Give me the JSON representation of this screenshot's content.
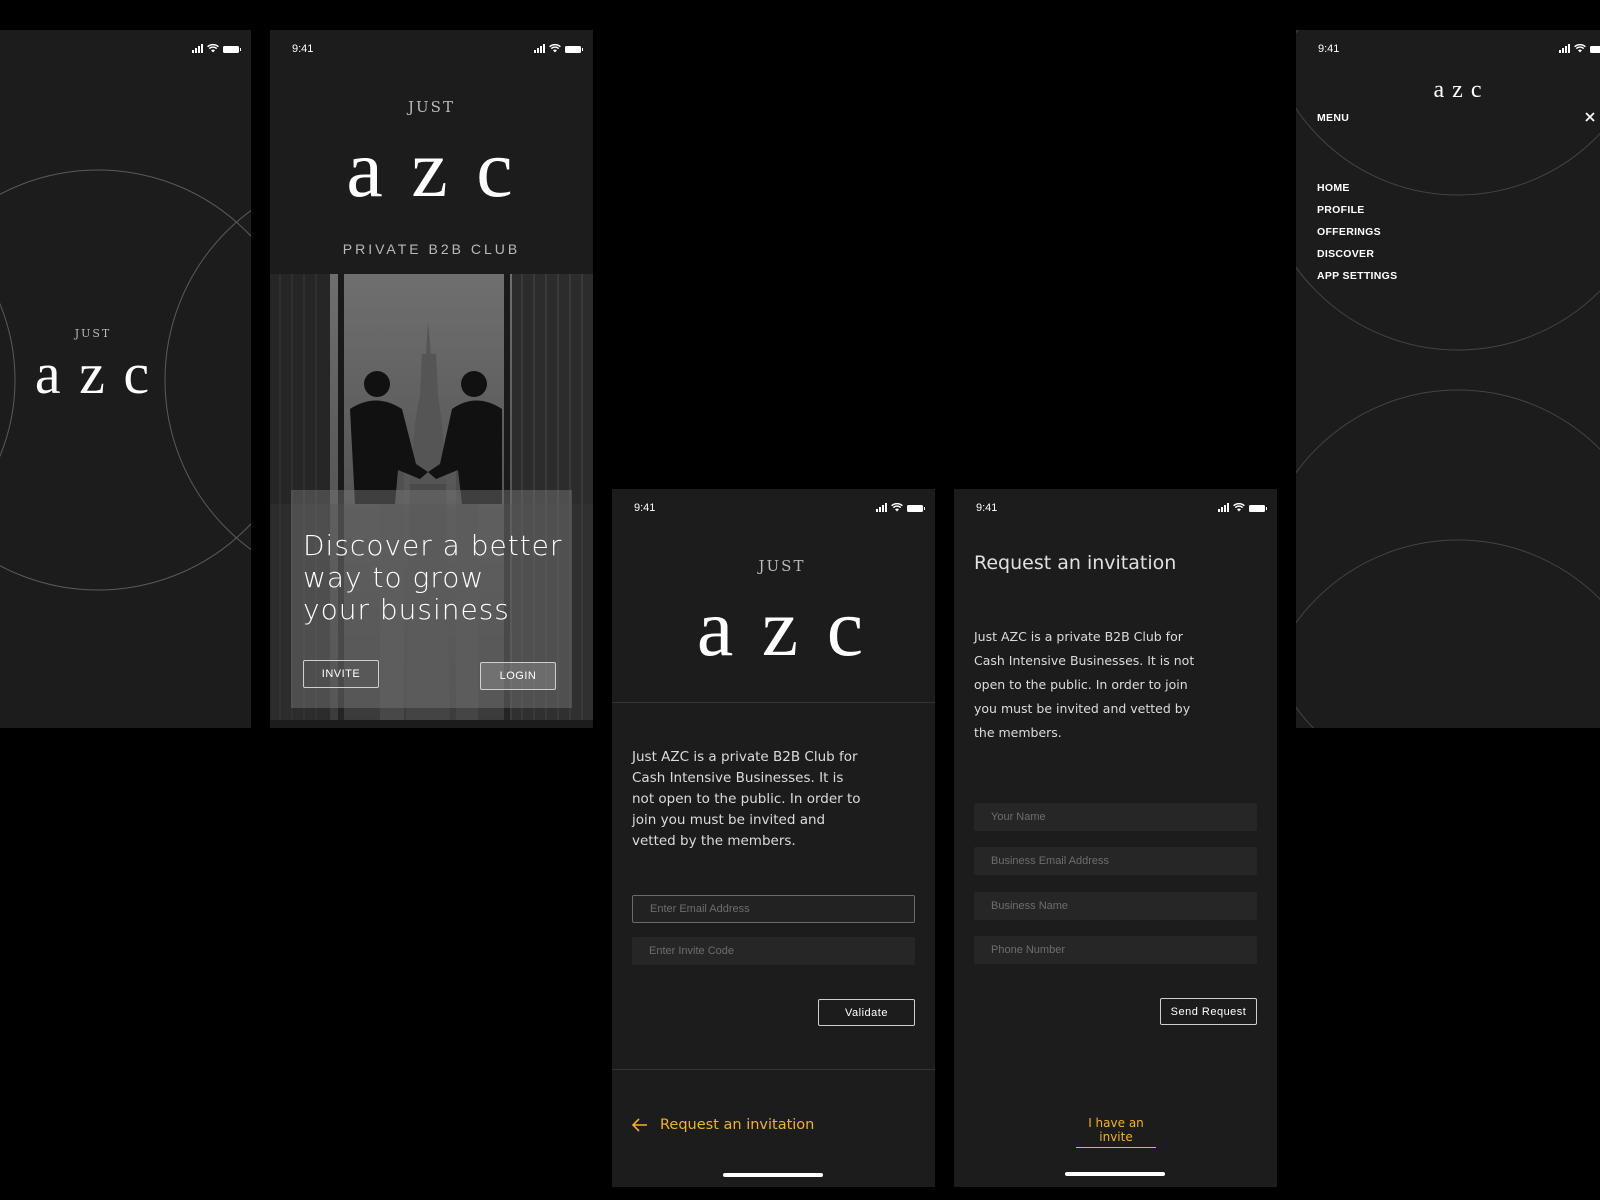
{
  "status": {
    "time": "9:41"
  },
  "splash": {
    "logo_just": "JUST",
    "logo_azc": "a z c"
  },
  "landing": {
    "logo_just": "JUST",
    "logo_azc": "a z c",
    "tagline": "PRIVATE B2B CLUB",
    "headline": [
      "Discover a better",
      "way to grow",
      "your business"
    ],
    "invite_label": "INVITE",
    "login_label": "LOGIN"
  },
  "validate": {
    "logo_just": "JUST",
    "logo_azc": "a z c",
    "description": [
      "Just AZC is a private B2B Club for",
      "Cash Intensive Businesses. It is",
      "not open to the public. In order to",
      "join you must be invited and",
      "vetted by the members."
    ],
    "email_placeholder": "Enter Email Address",
    "code_placeholder": "Enter Invite Code",
    "validate_label": "Validate",
    "request_link": "Request an invitation"
  },
  "request": {
    "title": "Request an invitation",
    "description": [
      "Just AZC is a private B2B Club for",
      "Cash Intensive Businesses. It is not",
      "open to the public. In order to join",
      "you must be invited and vetted by",
      "the members."
    ],
    "name_placeholder": "Your Name",
    "email_placeholder": "Business Email Address",
    "business_placeholder": "Business Name",
    "phone_placeholder": "Phone Number",
    "send_label": "Send Request",
    "have_invite_link": "I have an invite"
  },
  "menu": {
    "logo": "a z c",
    "title": "MENU",
    "items": [
      "HOME",
      "PROFILE",
      "OFFERINGS",
      "DISCOVER",
      "APP SETTINGS"
    ]
  },
  "colors": {
    "accent": "#f2b320",
    "screen_bg": "#1c1c1c",
    "field_bg": "#262626"
  },
  "icons": {
    "close": "close-icon",
    "back": "arrow-left-icon",
    "signal": "signal-icon",
    "wifi": "wifi-icon",
    "battery": "battery-icon"
  }
}
